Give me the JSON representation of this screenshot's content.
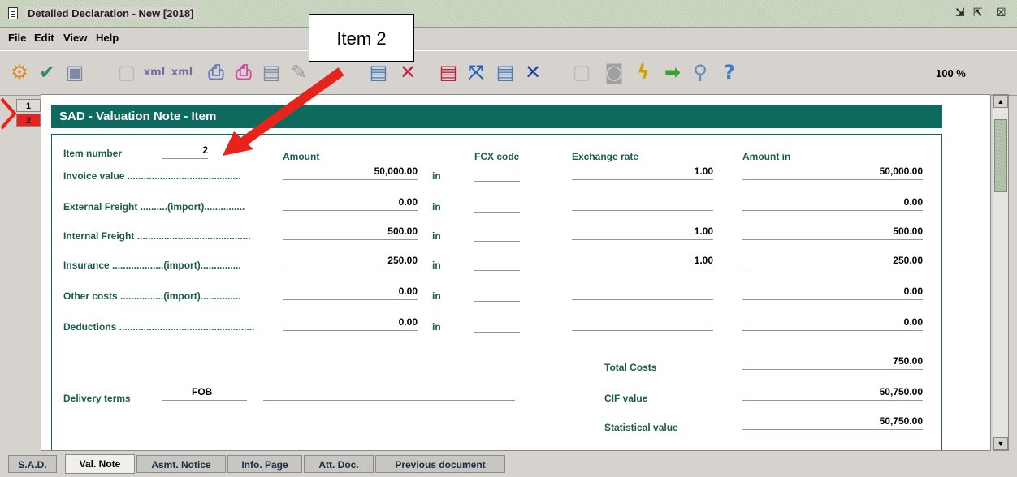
{
  "window": {
    "title": "Detailed Declaration - New [2018]"
  },
  "menu": [
    "File",
    "Edit",
    "View",
    "Help"
  ],
  "toolbar": {
    "zoom": "100 %"
  },
  "callout": {
    "label": "Item 2"
  },
  "item_tabs": [
    "1",
    "2"
  ],
  "header": {
    "title": "SAD - Valuation Note - Item"
  },
  "form": {
    "item_number_label": "Item number",
    "item_number": "2",
    "columns": {
      "amount": "Amount",
      "fcx": "FCX code",
      "rate": "Exchange rate",
      "amount_in": "Amount in"
    },
    "in_label": "in",
    "rows": [
      {
        "label": "Invoice value ..........................................",
        "amount": "50,000.00",
        "fcx": "",
        "rate": "1.00",
        "amount_in": "50,000.00"
      },
      {
        "label": "External Freight ..........(import)...............",
        "amount": "0.00",
        "fcx": "",
        "rate": "",
        "amount_in": "0.00"
      },
      {
        "label": "Internal Freight ..........................................",
        "amount": "500.00",
        "fcx": "",
        "rate": "1.00",
        "amount_in": "500.00"
      },
      {
        "label": "Insurance ...................(import)...............",
        "amount": "250.00",
        "fcx": "",
        "rate": "1.00",
        "amount_in": "250.00"
      },
      {
        "label": "Other costs ................(import)...............",
        "amount": "0.00",
        "fcx": "",
        "rate": "",
        "amount_in": "0.00"
      },
      {
        "label": "Deductions ..................................................",
        "amount": "0.00",
        "fcx": "",
        "rate": "",
        "amount_in": "0.00"
      }
    ],
    "total_costs_label": "Total Costs",
    "total_costs": "750.00",
    "delivery_terms_label": "Delivery terms",
    "delivery_terms": "FOB",
    "cif_label": "CIF value",
    "cif": "50,750.00",
    "statistical_label": "Statistical value",
    "statistical": "50,750.00"
  },
  "bottom_tabs": [
    "S.A.D.",
    "Val. Note",
    "Asmt. Notice",
    "Info. Page",
    "Att. Doc.",
    "Previous document"
  ],
  "colors": {
    "header": "#0e6a5e",
    "label": "#1b5a50",
    "arrow": "#e8231c"
  }
}
